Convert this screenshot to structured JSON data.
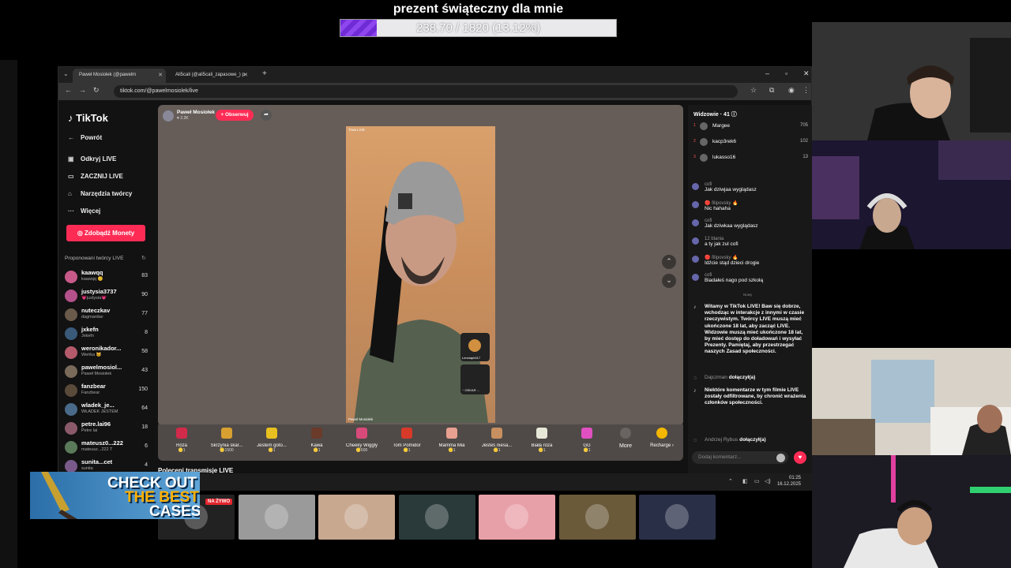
{
  "goal": {
    "title": "prezent świąteczny dla mnie",
    "progress_text": "238.70 / 1820 (13.12%)",
    "progress_fraction": 0.1312
  },
  "browser": {
    "tabs": [
      {
        "label": "Paweł Mosiołek (@pawelm"
      },
      {
        "label": "Ali5cali (@ali5cali_zapasowe_) p"
      }
    ],
    "url": "tiktok.com/@pawelmosiolek/live"
  },
  "tiktok": {
    "logo": "TikTok",
    "nav": [
      {
        "label": "Powrót",
        "icon": "back-arrow-icon"
      },
      {
        "label": "Odkryj LIVE",
        "icon": "live-icon"
      },
      {
        "label": "ZACZNIJ LIVE",
        "icon": "camera-icon"
      },
      {
        "label": "Narzędzia twórcy",
        "icon": "tools-icon"
      },
      {
        "label": "Więcej",
        "icon": "more-icon"
      }
    ],
    "coins_button": "Zdobądź Monety",
    "suggested_title": "Proponowani twórcy LIVE",
    "creators": [
      {
        "name": "kaawqq",
        "sub": "kaawqq 😊",
        "count": "83",
        "color": "#c85a8a"
      },
      {
        "name": "justysia3737",
        "sub": "💗justysia💗",
        "count": "90",
        "color": "#b4508a"
      },
      {
        "name": "nuteczkav",
        "sub": "dagmardav",
        "count": "77",
        "color": "#6a5a4a"
      },
      {
        "name": "jxkefn",
        "sub": "Jxkefn",
        "count": "8",
        "color": "#3a5a7a"
      },
      {
        "name": "weronikador...",
        "sub": "Weńka 🐱",
        "count": "58",
        "color": "#b45a6a"
      },
      {
        "name": "pawelmosiol...",
        "sub": "Paweł Mosiołek",
        "count": "43",
        "color": "#7a6a5a"
      },
      {
        "name": "fanzbear",
        "sub": "Fanzbear",
        "count": "150",
        "color": "#5a4a3a"
      },
      {
        "name": "wladek_je...",
        "sub": "WŁADEK JESTEM",
        "count": "64",
        "color": "#4a6a8a"
      },
      {
        "name": "petre.lai96",
        "sub": "Petre lai",
        "count": "18",
        "color": "#8a5a6a"
      },
      {
        "name": "mateusz0...222",
        "sub": "mateusz...222 T",
        "count": "6",
        "color": "#5a7a5a"
      },
      {
        "name": "sunita...cet",
        "sub": "sunita",
        "count": "4",
        "color": "#7a5a8a"
      }
    ],
    "host": {
      "name": "Paweł Mosiołek",
      "likes": "♥ 2.2K",
      "follow": "+ Obserwuj"
    },
    "video_label": "Trwa LIVE",
    "video_name": "Paweł Mosiołek",
    "side_thumb_label": "Lenniapb017",
    "side_thumb_label2": "~ OSKAR ...",
    "gifts": [
      {
        "name": "Róża",
        "price": "🪙1",
        "color": "#d22a4a"
      },
      {
        "name": "Skrzynia skar...",
        "price": "🪙1500",
        "color": "#d8a030"
      },
      {
        "name": "Jestem goto...",
        "price": "🪙1",
        "color": "#e8c020"
      },
      {
        "name": "Kawa",
        "price": "🪙1",
        "color": "#6a3a2a"
      },
      {
        "name": "Cheeky Wiggly",
        "price": "🪙500",
        "color": "#d84a7a"
      },
      {
        "name": "Tom Pomidor",
        "price": "🪙1",
        "color": "#d83a2a"
      },
      {
        "name": "Mamma Mia",
        "price": "🪙1",
        "color": "#e8a090"
      },
      {
        "name": "Jesteś niesa...",
        "price": "🪙1",
        "color": "#c89060"
      },
      {
        "name": "Biała róża",
        "price": "🪙1",
        "color": "#e8e8d8"
      },
      {
        "name": "GG",
        "price": "🪙1",
        "color": "#e050c0"
      }
    ],
    "more_label": "More",
    "recharge_label": "Recharge ›",
    "previous_live": "Poleceni transmisje LIVE",
    "chat": {
      "viewers_title": "Widzowie · 41 ⓘ",
      "top_viewers": [
        {
          "rank": "1",
          "name": "Margee",
          "count": "705"
        },
        {
          "rank": "2",
          "name": "kacp3rek6",
          "count": "102"
        },
        {
          "rank": "3",
          "name": "lukasso16",
          "count": "13"
        }
      ],
      "messages": [
        {
          "user": "cofi",
          "text": "Jak dziwjaa wyglądasz"
        },
        {
          "user": "🔴 filipovsky 🔥",
          "text": "Nic hahaha"
        },
        {
          "user": "cofi",
          "text": "Jak dziwkaa wyglądasz"
        },
        {
          "user": "12 blania",
          "text": "a ty jak zul cofi"
        },
        {
          "user": "🔴 filipovsky 🔥",
          "text": "Idźcie stąd dzieci drogie"
        },
        {
          "user": "cofi",
          "text": "Biadałeś nago pod szkołą"
        }
      ],
      "separator": "Nowy",
      "welcome": "Witamy w TikTok LIVE! Baw się dobrze, wchodząc w interakcje z innymi w czasie rzeczywistym. Twórcy LIVE muszą mieć ukończone 18 lat, aby zacząć LIVE. Widzowie muszą mieć ukończone 18 lat, by mieć dostęp do doładowań i wysyłać Prezenty. Pamiętaj, aby przestrzegać naszych Zasad społeczności.",
      "join1_user": "Dajczman",
      "join1_text": "dołączył(a)",
      "filter_notice": "Niektóre komentarze w tym filmie LIVE zostały odfiltrowane, by chronić wrażenia członków społeczności.",
      "join2_user": "Andrzej Rybus",
      "join2_text": "dołączył(a)",
      "input_placeholder": "Dodaj komentarz..."
    }
  },
  "taskbar": {
    "time": "01:25",
    "date": "16.12.2025"
  },
  "bottom": {
    "live_badge": "NA ŻYWO",
    "thumb_colors": [
      "#222",
      "#9a9a9a",
      "#c9a890",
      "#2a3a3a",
      "#e8a0a8",
      "#6a5a3a",
      "#2a2f48"
    ]
  },
  "promo": {
    "line1": "CHECK OUT",
    "line2": "THE BEST",
    "line3": "CASES"
  }
}
